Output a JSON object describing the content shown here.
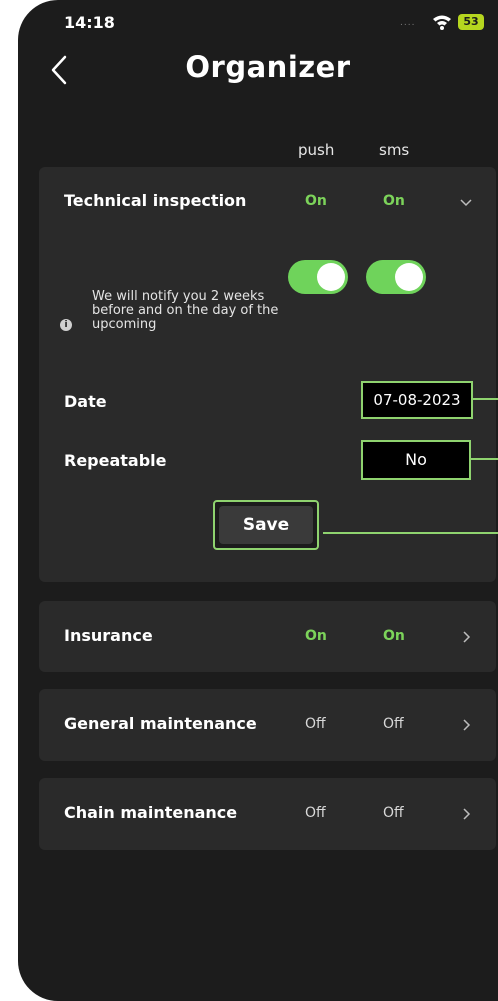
{
  "status_bar": {
    "time": "14:18",
    "signal": "....",
    "battery": "53"
  },
  "header": {
    "title": "Organizer"
  },
  "columns": {
    "push": "push",
    "sms": "sms"
  },
  "technical_inspection": {
    "label": "Technical inspection",
    "push_state": "On",
    "sms_state": "On",
    "push_enabled": true,
    "sms_enabled": true,
    "info": "We will notify you 2 weeks before and on the day of the upcoming",
    "date_label": "Date",
    "date_value": "07-08-2023",
    "repeatable_label": "Repeatable",
    "repeatable_value": "No",
    "save_label": "Save"
  },
  "items": [
    {
      "label": "Insurance",
      "push": "On",
      "sms": "On"
    },
    {
      "label": "General maintenance",
      "push": "Off",
      "sms": "Off"
    },
    {
      "label": "Chain maintenance",
      "push": "Off",
      "sms": "Off"
    }
  ],
  "colors": {
    "accent_green": "#7cd35a",
    "background": "#1c1c1c",
    "card": "#2a2a2a"
  }
}
